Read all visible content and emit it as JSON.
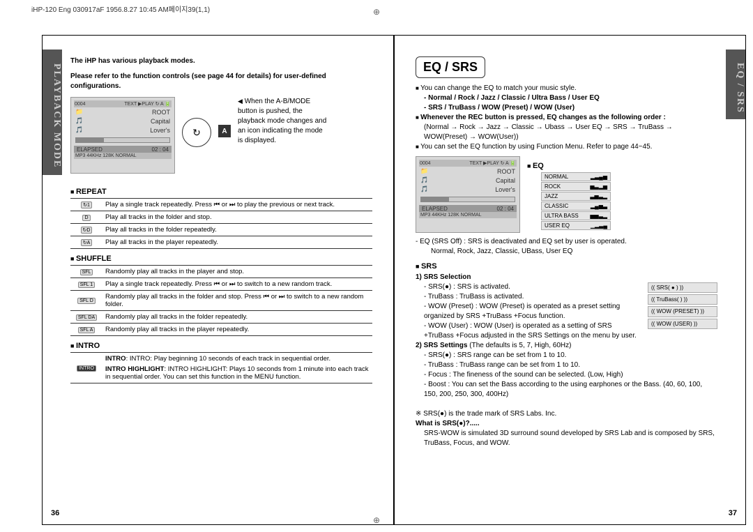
{
  "meta": {
    "header": "iHP-120 Eng 030917aF   1956.8.27 10:45 AM페이지39(1,1)"
  },
  "left": {
    "tab": "PLAYBACK MODE",
    "intro1": "The iHP has various playback modes.",
    "intro2": "Please refer to the function controls (see page 44 for details) for user-defined configurations.",
    "side_desc": "When the A-B/MODE button is pushed, the playback mode changes and an icon indicating the mode is displayed.",
    "mode_letter": "A",
    "screen": {
      "track": "0004",
      "root": "ROOT",
      "line1": "Capital",
      "line2": "Lover's",
      "elapsed_label": "ELAPSED",
      "elapsed_time": "02 : 04",
      "bottom": "MP3  44KHz  128K  NORMAL"
    },
    "repeat": {
      "title": "REPEAT",
      "rows": [
        {
          "icon": "↻1",
          "text": "Play a single track repeatedly. Press ⏮ or ⏭ to play the previous or next track."
        },
        {
          "icon": "D",
          "text": "Play all tracks in the folder and stop."
        },
        {
          "icon": "↻D",
          "text": "Play all tracks in the folder repeatedly."
        },
        {
          "icon": "↻A",
          "text": "Play all tracks in the player repeatedly."
        }
      ]
    },
    "shuffle": {
      "title": "SHUFFLE",
      "rows": [
        {
          "icon": "SFL",
          "text": "Randomly play all tracks in the player and stop."
        },
        {
          "icon": "SFL 1",
          "text": "Play a single track repeatedly. Press ⏮ or ⏭ to switch to a new random track."
        },
        {
          "icon": "SFL D",
          "text": "Randomly play all tracks in the folder and stop. Press ⏮ or ⏭ to switch to a new random folder."
        },
        {
          "icon": "SFL DA",
          "text": "Randomly play all tracks in the folder repeatedly."
        },
        {
          "icon": "SFL A",
          "text": "Randomly play all tracks in the player repeatedly."
        }
      ]
    },
    "intro": {
      "title": "INTRO",
      "row1_label": "INTRO",
      "row1_text": "INTRO: Play beginning 10 seconds of each track in sequential order.",
      "row2_text": "INTRO HIGHLIGHT: Plays 10 seconds from 1 minute into each track in sequential order. You can set this function in the MENU function."
    },
    "page_num": "36"
  },
  "right": {
    "tab": "EQ / SRS",
    "title": "EQ / SRS",
    "bullets": {
      "l1": "You can change the EQ to match your music style.",
      "l2": "- Normal / Rock / Jazz / Classic / Ultra Bass / User EQ",
      "l3": "- SRS / TruBass / WOW (Preset) / WOW (User)",
      "l4": "Whenever the REC button is pressed, EQ changes as the following order :",
      "l5": "(Normal → Rock → Jazz → Classic → Ubass → User EQ → SRS → TruBass → WOW(Preset) → WOW(User))",
      "l6": "You can set the EQ function by using Function Menu. Refer to page 44~45."
    },
    "screen": {
      "track": "0004",
      "root": "ROOT",
      "line1": "Capital",
      "line2": "Lover's",
      "elapsed_label": "ELAPSED",
      "elapsed_time": "02 : 04",
      "bottom": "MP3  44KHz  128K  NORMAL"
    },
    "eq_title": "EQ",
    "eq_items": [
      "NORMAL",
      "ROCK",
      "JAZZ",
      "CLASSIC",
      "ULTRA BASS",
      "USER EQ"
    ],
    "eq_off": "- EQ (SRS Off) : SRS is deactivated and EQ set by user is operated.",
    "eq_off2": "Normal, Rock, Jazz, Classic, UBass, User EQ",
    "srs_title": "SRS",
    "srs_sel_head": "1) SRS Selection",
    "srs_sel": {
      "a": "- SRS(●) : SRS is activated.",
      "b": "- TruBass : TruBass is activated.",
      "c": "- WOW (Preset) : WOW (Preset) is operated as a preset setting organized by SRS +TruBass +Focus function.",
      "d": "- WOW (User) : WOW (User) is operated as a setting of SRS +TruBass +Focus adjusted in the SRS Settings on the menu by user."
    },
    "srs_items": [
      "SRS( ● )",
      "TruBass( )",
      "WOW (PRESET)",
      "WOW (USER)"
    ],
    "srs_set_head": "2) SRS Settings",
    "srs_set_def": "(The defaults is 5, 7, High, 60Hz)",
    "srs_set": {
      "a": "- SRS(●) : SRS range can be set from 1 to 10.",
      "b": "- TruBass : TruBass range can be set from 1 to 10.",
      "c": "- Focus : The fineness of the sound can be selected. (Low, High)",
      "d": "- Boost : You can set the Bass according to the using earphones or the Bass. (40, 60, 100, 150, 200, 250, 300, 400Hz)"
    },
    "trademark": "※ SRS(●) is the trade mark of SRS Labs. Inc.",
    "what_head": "What is SRS(●)?.....",
    "what_text": "SRS-WOW is simulated 3D surround sound developed by SRS Lab and is composed by SRS, TruBass, Focus, and WOW.",
    "page_num": "37"
  }
}
